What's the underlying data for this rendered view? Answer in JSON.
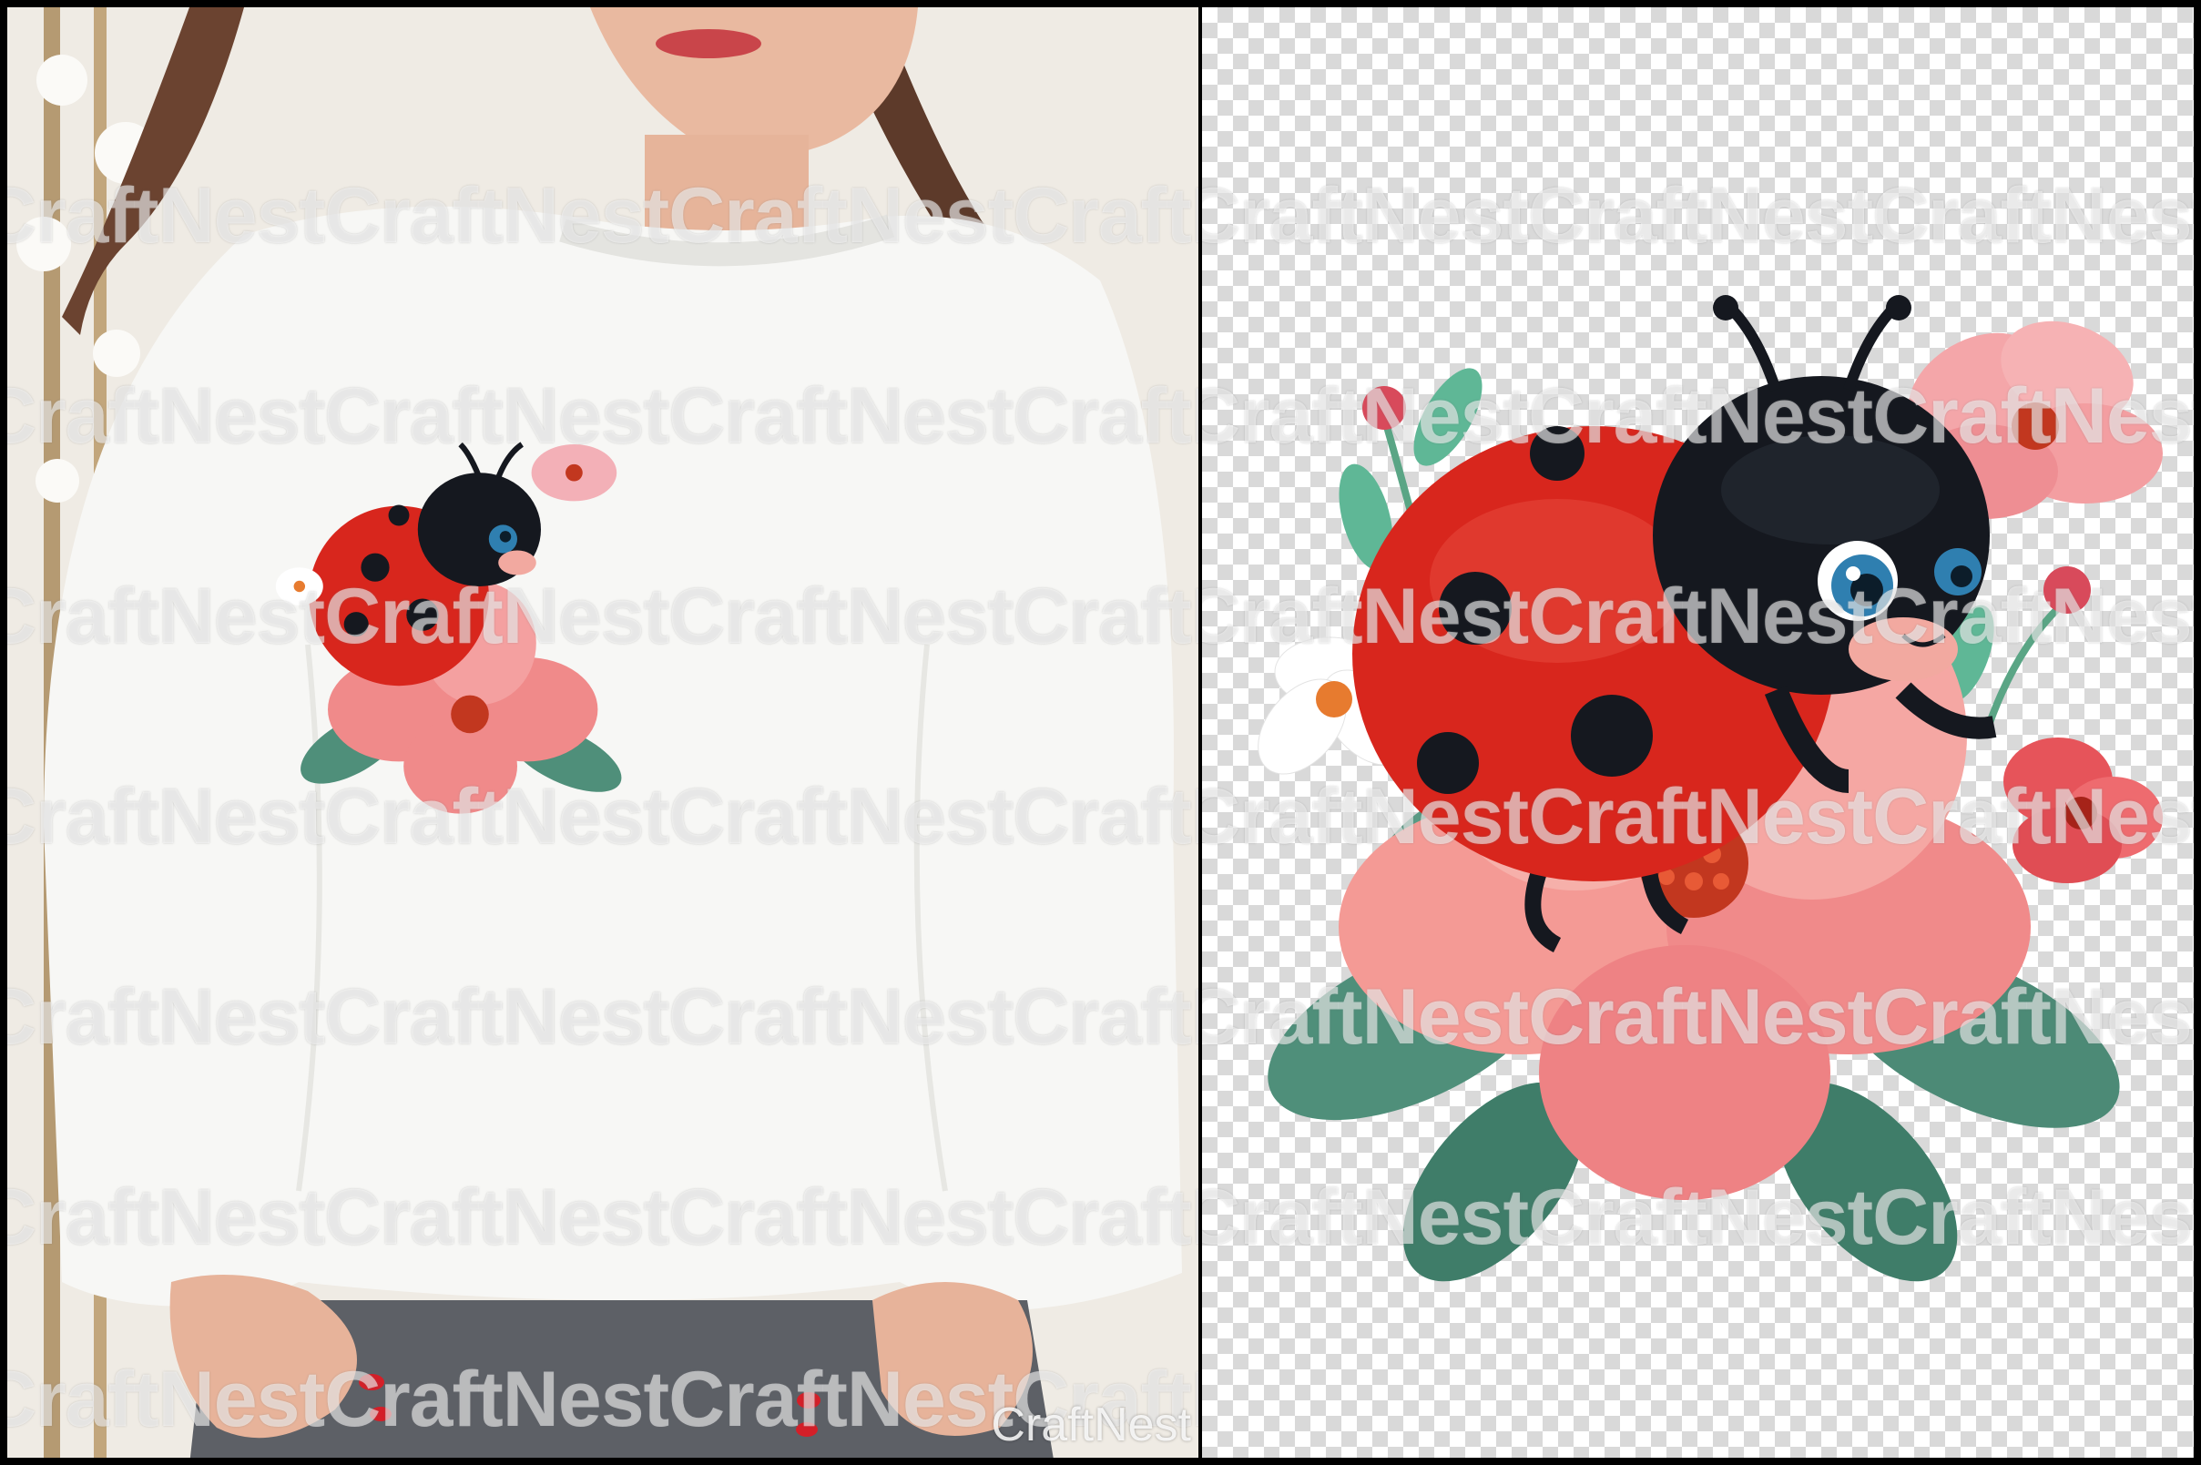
{
  "watermark": {
    "repeat_text": "CraftNestCraftNestCraftNestCraftNestCraftNest",
    "corner_text": "CraftNest"
  },
  "colors": {
    "ladybug_red": "#d8261d",
    "ladybug_black": "#15181f",
    "petal_pink": "#f08a8a",
    "leaf_green": "#4f8f7a",
    "sweater_white": "#f7f7f5",
    "jeans_gray": "#5d6066"
  }
}
